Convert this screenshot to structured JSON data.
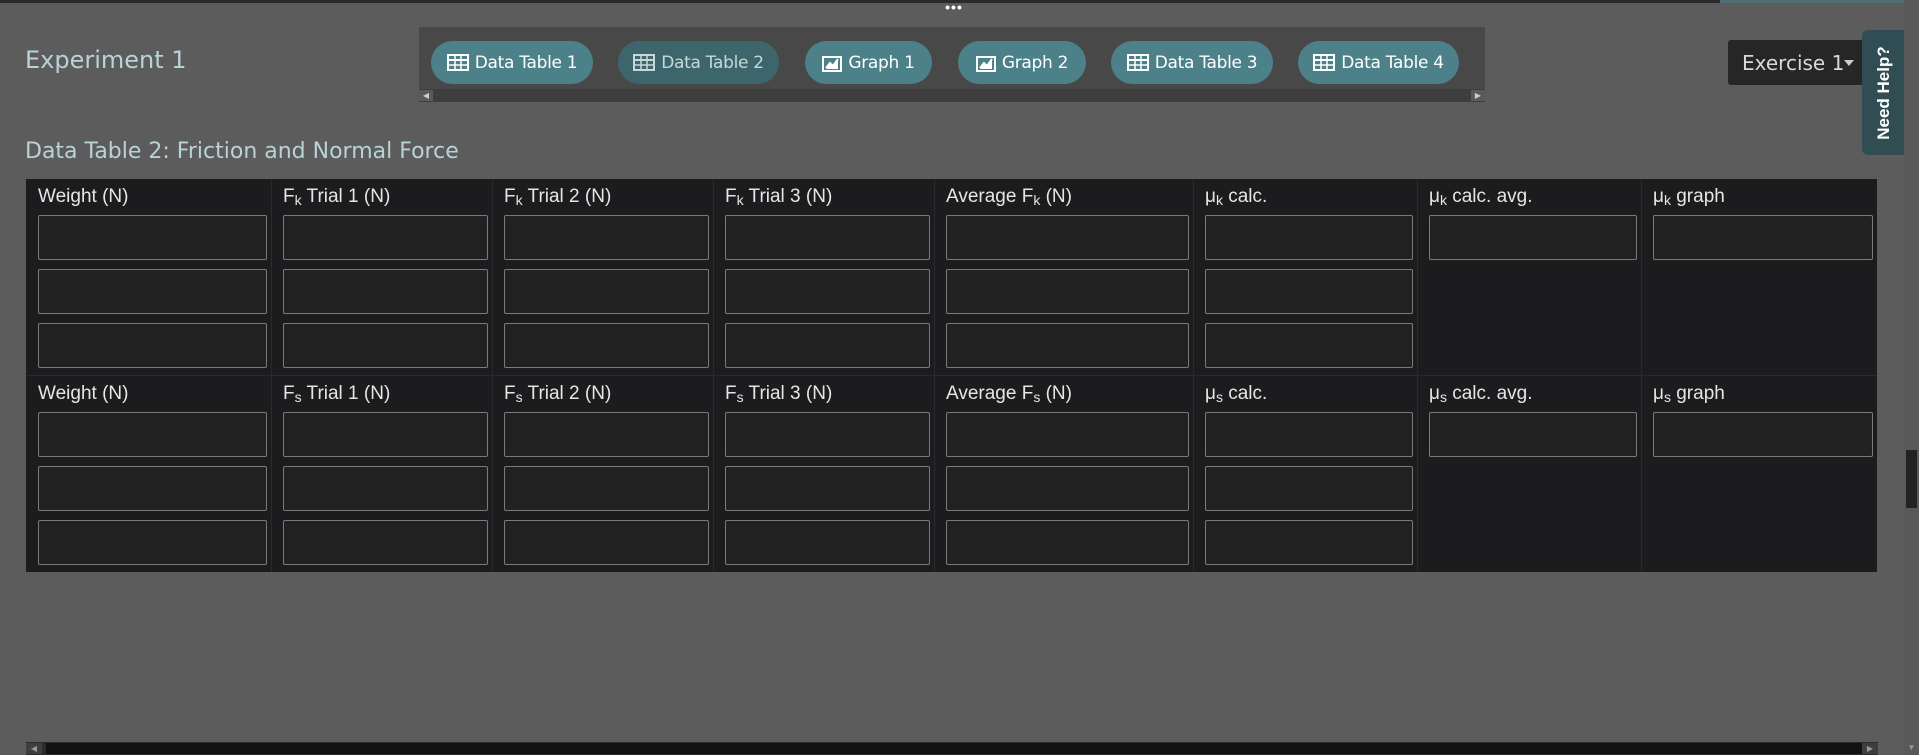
{
  "drag_handle": "•••",
  "experiment_title": "Experiment 1",
  "tabs": [
    {
      "label": "Data Table 1",
      "icon": "table-icon",
      "active": false
    },
    {
      "label": "Data Table 2",
      "icon": "table-icon",
      "active": true
    },
    {
      "label": "Graph 1",
      "icon": "graph-icon",
      "active": false
    },
    {
      "label": "Graph 2",
      "icon": "graph-icon",
      "active": false
    },
    {
      "label": "Data Table 3",
      "icon": "table-icon",
      "active": false
    },
    {
      "label": "Data Table 4",
      "icon": "table-icon",
      "active": false
    }
  ],
  "exercise_select": {
    "value": "Exercise 1"
  },
  "help_label": "Need Help?",
  "section_title": "Data Table 2: Friction and Normal Force",
  "kinetic_headers": {
    "weight": "Weight (N)",
    "f1_base": "F",
    "f1_sub": "k",
    "f1_tail": " Trial 1 (N)",
    "f2_base": "F",
    "f2_sub": "k",
    "f2_tail": " Trial 2 (N)",
    "f3_base": "F",
    "f3_sub": "k",
    "f3_tail": " Trial 3 (N)",
    "avg_base": "Average F",
    "avg_sub": "k",
    "avg_tail": " (N)",
    "mu_calc_base": "μ",
    "mu_calc_sub": "k",
    "mu_calc_tail": " calc.",
    "mu_avg_base": "μ",
    "mu_avg_sub": "k",
    "mu_avg_tail": " calc. avg.",
    "mu_graph_base": "μ",
    "mu_graph_sub": "k",
    "mu_graph_tail": " graph"
  },
  "static_headers": {
    "weight": "Weight (N)",
    "f1_base": "F",
    "f1_sub": "s",
    "f1_tail": " Trial 1 (N)",
    "f2_base": "F",
    "f2_sub": "s",
    "f2_tail": " Trial 2 (N)",
    "f3_base": "F",
    "f3_sub": "s",
    "f3_tail": " Trial 3 (N)",
    "avg_base": "Average F",
    "avg_sub": "s",
    "avg_tail": " (N)",
    "mu_calc_base": "μ",
    "mu_calc_sub": "s",
    "mu_calc_tail": " calc.",
    "mu_avg_base": "μ",
    "mu_avg_sub": "s",
    "mu_avg_tail": " calc. avg.",
    "mu_graph_base": "μ",
    "mu_graph_sub": "s",
    "mu_graph_tail": " graph"
  },
  "kinetic_values": {
    "rows": [
      {
        "weight": "",
        "f1": "",
        "f2": "",
        "f3": "",
        "avg": "",
        "mu_calc": ""
      },
      {
        "weight": "",
        "f1": "",
        "f2": "",
        "f3": "",
        "avg": "",
        "mu_calc": ""
      },
      {
        "weight": "",
        "f1": "",
        "f2": "",
        "f3": "",
        "avg": "",
        "mu_calc": ""
      }
    ],
    "mu_avg": "",
    "mu_graph": ""
  },
  "static_values": {
    "rows": [
      {
        "weight": "",
        "f1": "",
        "f2": "",
        "f3": "",
        "avg": "",
        "mu_calc": ""
      },
      {
        "weight": "",
        "f1": "",
        "f2": "",
        "f3": "",
        "avg": "",
        "mu_calc": ""
      },
      {
        "weight": "",
        "f1": "",
        "f2": "",
        "f3": "",
        "avg": "",
        "mu_calc": ""
      }
    ],
    "mu_avg": "",
    "mu_graph": ""
  },
  "colors": {
    "background": "#5c5c5c",
    "tab": "#4d8189",
    "tab_active": "#3d666c",
    "title_text": "#b8d3d6",
    "grid_bg": "#1c1c1f",
    "help_bg": "#2f4d52"
  }
}
